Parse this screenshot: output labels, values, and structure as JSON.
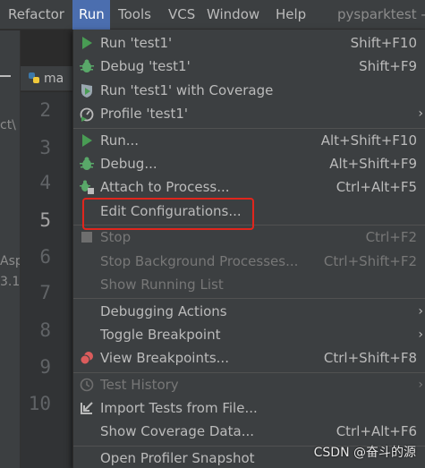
{
  "menubar": {
    "refactor": "Refactor",
    "run": "Run",
    "tools": "Tools",
    "vcs": "VCS",
    "window": "Window",
    "help": "Help",
    "project_name": "pysparktest -"
  },
  "left_panel": {
    "frag_1": "ct\\",
    "frag_2": "Asp",
    "frag_3": "3.1"
  },
  "editor": {
    "tab_label": "ma",
    "line_numbers": [
      "2",
      "3",
      "4",
      "5",
      "6",
      "7",
      "8",
      "9",
      "10"
    ],
    "current_line": "5"
  },
  "run_menu": {
    "items": [
      {
        "label": "Run 'test1'",
        "shortcut": "Shift+F10",
        "icon": "run-icon"
      },
      {
        "label": "Debug 'test1'",
        "shortcut": "Shift+F9",
        "icon": "debug-icon"
      },
      {
        "label": "Run 'test1' with Coverage",
        "shortcut": "",
        "icon": "coverage-icon"
      },
      {
        "label": "Profile 'test1'",
        "shortcut": "",
        "icon": "profile-icon",
        "submenu": true
      },
      {
        "label": "Run...",
        "shortcut": "Alt+Shift+F10",
        "icon": "run-icon"
      },
      {
        "label": "Debug...",
        "shortcut": "Alt+Shift+F9",
        "icon": "debug-icon"
      },
      {
        "label": "Attach to Process...",
        "shortcut": "Ctrl+Alt+F5",
        "icon": "attach-icon"
      },
      {
        "label": "Edit Configurations...",
        "shortcut": "",
        "icon": ""
      },
      {
        "label": "Stop",
        "shortcut": "Ctrl+F2",
        "icon": "stop-icon",
        "disabled": true
      },
      {
        "label": "Stop Background Processes...",
        "shortcut": "Ctrl+Shift+F2",
        "icon": "",
        "disabled": true
      },
      {
        "label": "Show Running List",
        "shortcut": "",
        "icon": "",
        "disabled": true
      },
      {
        "label": "Debugging Actions",
        "shortcut": "",
        "icon": "",
        "submenu": true
      },
      {
        "label": "Toggle Breakpoint",
        "shortcut": "",
        "icon": "",
        "submenu": true
      },
      {
        "label": "View Breakpoints...",
        "shortcut": "Ctrl+Shift+F8",
        "icon": "breakpoints-icon"
      },
      {
        "label": "Test History",
        "shortcut": "",
        "icon": "history-icon",
        "disabled": true,
        "submenu": true
      },
      {
        "label": "Import Tests from File...",
        "shortcut": "",
        "icon": "import-icon"
      },
      {
        "label": "Show Coverage Data...",
        "shortcut": "Ctrl+Alt+F6",
        "icon": ""
      },
      {
        "label": "Open Profiler Snapshot",
        "shortcut": "",
        "icon": ""
      }
    ],
    "submenu_arrow": "›"
  },
  "watermark": "CSDN @奋斗的源",
  "colors": {
    "menu_bg": "#3c3f41",
    "editor_bg": "#2b2b2b",
    "active_menu": "#4b6eaf",
    "run_green": "#499c54",
    "debug_green": "#59a869",
    "breakpoint_red": "#db5c5c",
    "highlight_red": "#e0261d"
  }
}
